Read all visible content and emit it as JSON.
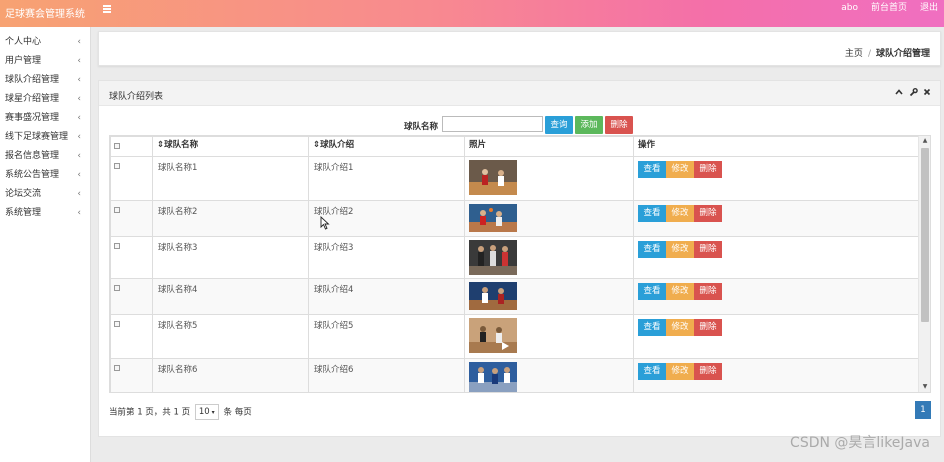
{
  "app": {
    "title": "足球赛会管理系统"
  },
  "topbar": {
    "user": "abo",
    "home_link": "前台首页",
    "logout": "退出"
  },
  "sidebar": {
    "items": [
      {
        "label": "个人中心"
      },
      {
        "label": "用户管理"
      },
      {
        "label": "球队介绍管理"
      },
      {
        "label": "球星介绍管理"
      },
      {
        "label": "赛事盛况管理"
      },
      {
        "label": "线下足球赛管理"
      },
      {
        "label": "报名信息管理"
      },
      {
        "label": "系统公告管理"
      },
      {
        "label": "论坛交流"
      },
      {
        "label": "系统管理"
      }
    ]
  },
  "breadcrumb": {
    "home": "主页",
    "separator": "/",
    "current": "球队介绍管理"
  },
  "panel": {
    "title": "球队介绍列表"
  },
  "search": {
    "label": "球队名称",
    "placeholder": "",
    "query_button": "查询",
    "add_button": "添加",
    "delete_button": "删除"
  },
  "table": {
    "headers": [
      "",
      "球队名称",
      "球队介绍",
      "照片",
      "操作"
    ],
    "rows": [
      {
        "name": "球队名称1",
        "intro": "球队介绍1"
      },
      {
        "name": "球队名称2",
        "intro": "球队介绍2"
      },
      {
        "name": "球队名称3",
        "intro": "球队介绍3"
      },
      {
        "name": "球队名称4",
        "intro": "球队介绍4"
      },
      {
        "name": "球队名称5",
        "intro": "球队介绍5"
      },
      {
        "name": "球队名称6",
        "intro": "球队介绍6"
      }
    ],
    "actions": {
      "view": "查看",
      "edit": "修改",
      "delete": "删除"
    }
  },
  "pager": {
    "prefix": "当前第 1 页，共 1 页",
    "page_size": "10",
    "suffix": "条 每页",
    "current_page": "1"
  },
  "watermark": "CSDN @昊言likeJava",
  "colors": {
    "primary": "#2a9fd8",
    "success": "#5cb85c",
    "warning": "#f0ad4e",
    "danger": "#d9534f"
  }
}
